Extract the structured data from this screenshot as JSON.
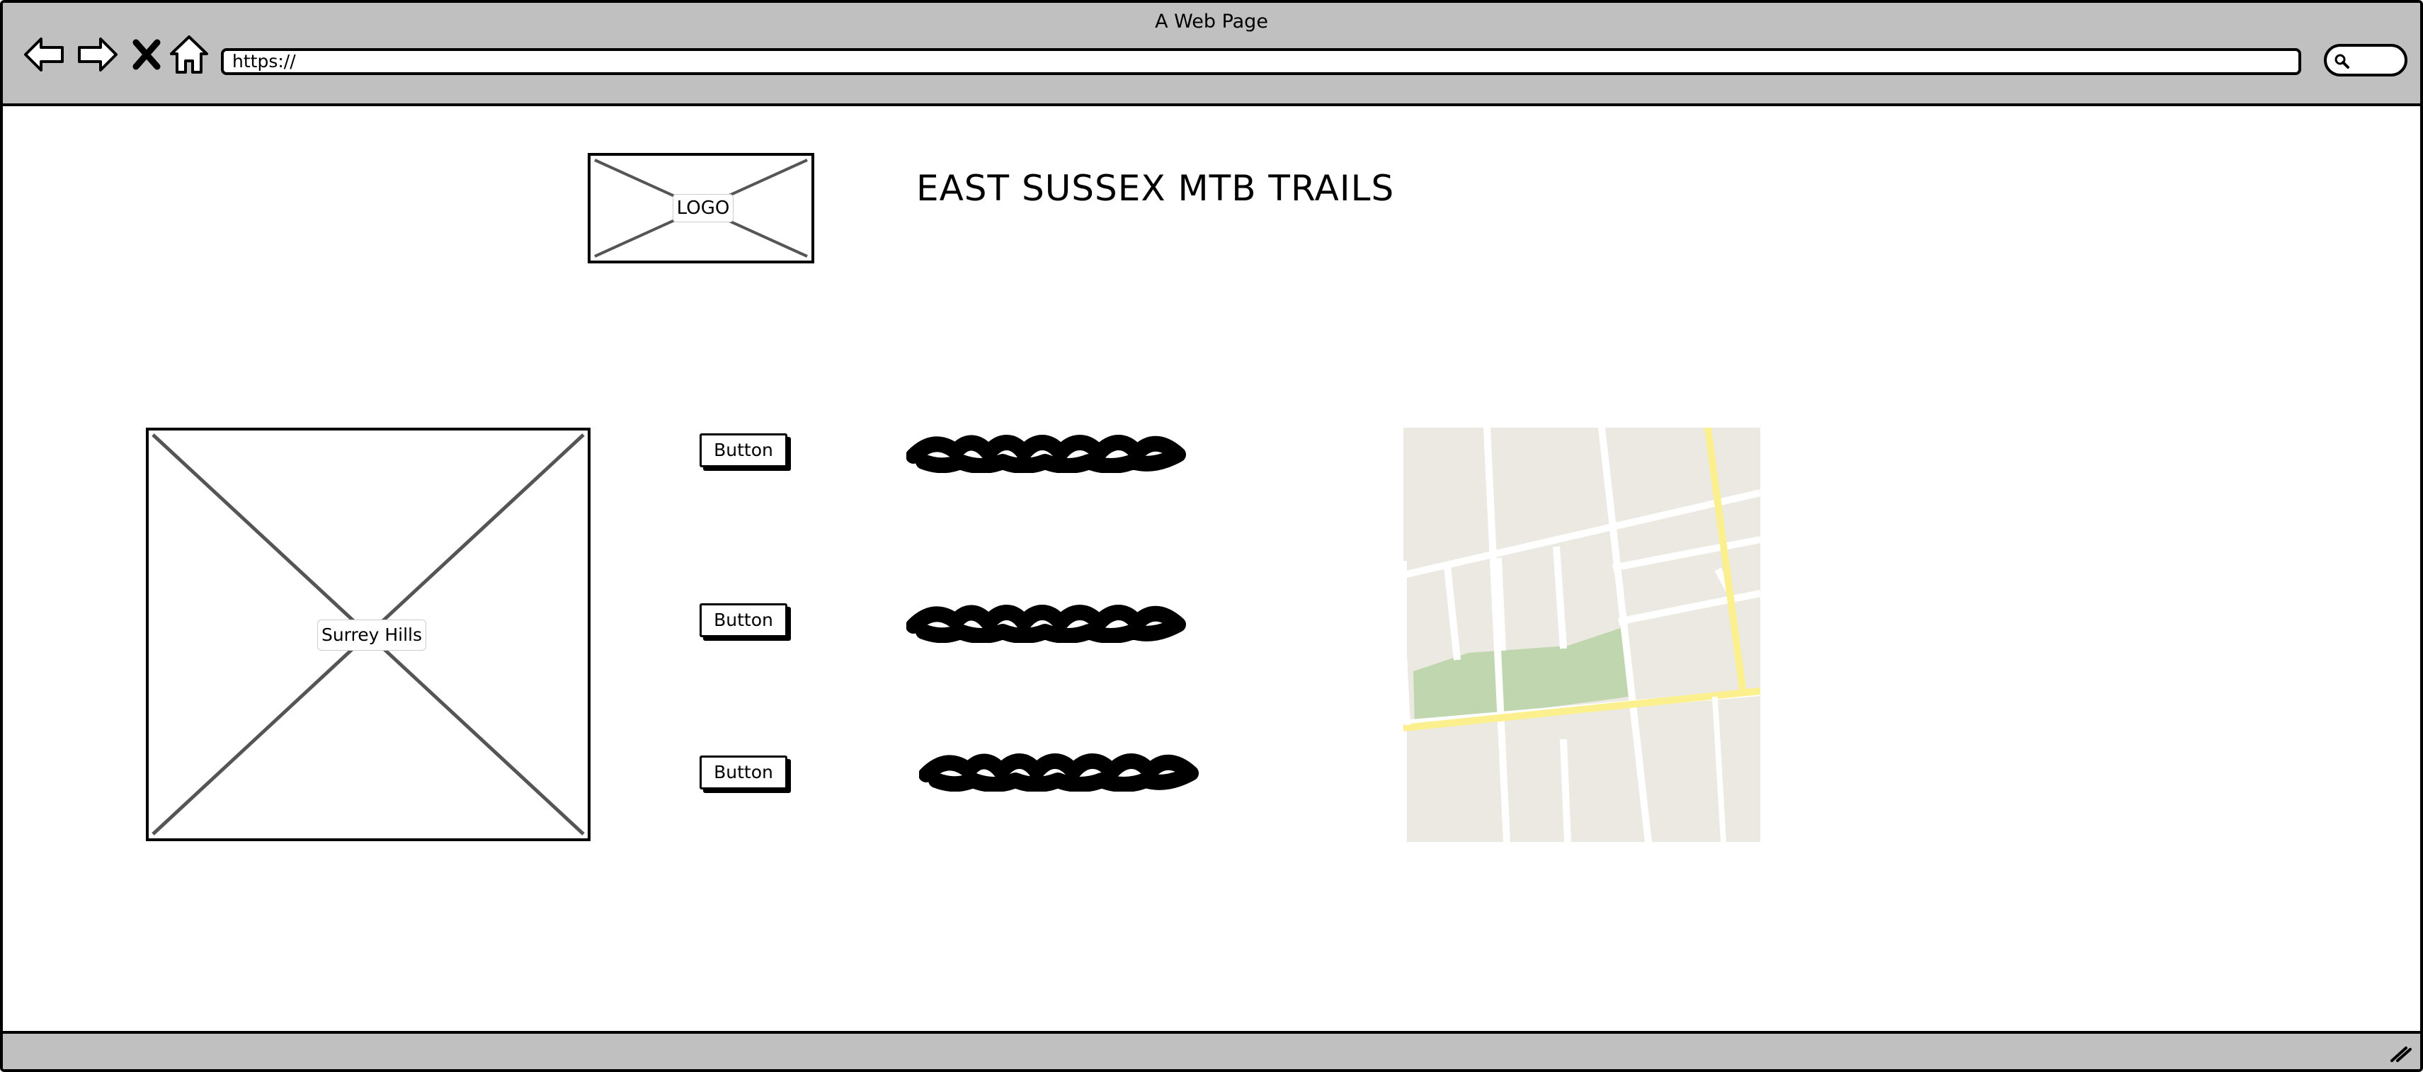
{
  "browser": {
    "window_title": "A Web Page",
    "address": "https://",
    "icons": [
      "back-arrow-icon",
      "forward-arrow-icon",
      "close-x-icon",
      "home-icon",
      "search-icon",
      "resize-grip-icon"
    ]
  },
  "header": {
    "logo_label": "LOGO",
    "site_title": "EAST SUSSEX MTB TRAILS"
  },
  "main": {
    "image_label": "Surrey Hills",
    "buttons": [
      {
        "label": "Button"
      },
      {
        "label": "Button"
      },
      {
        "label": "Button"
      }
    ]
  },
  "colors": {
    "chrome": "#c0c0c0",
    "map_land": "#ebe9e2",
    "map_park": "#bfd6af",
    "map_major_road": "#fcef8e",
    "map_minor_road": "#ffffff"
  }
}
